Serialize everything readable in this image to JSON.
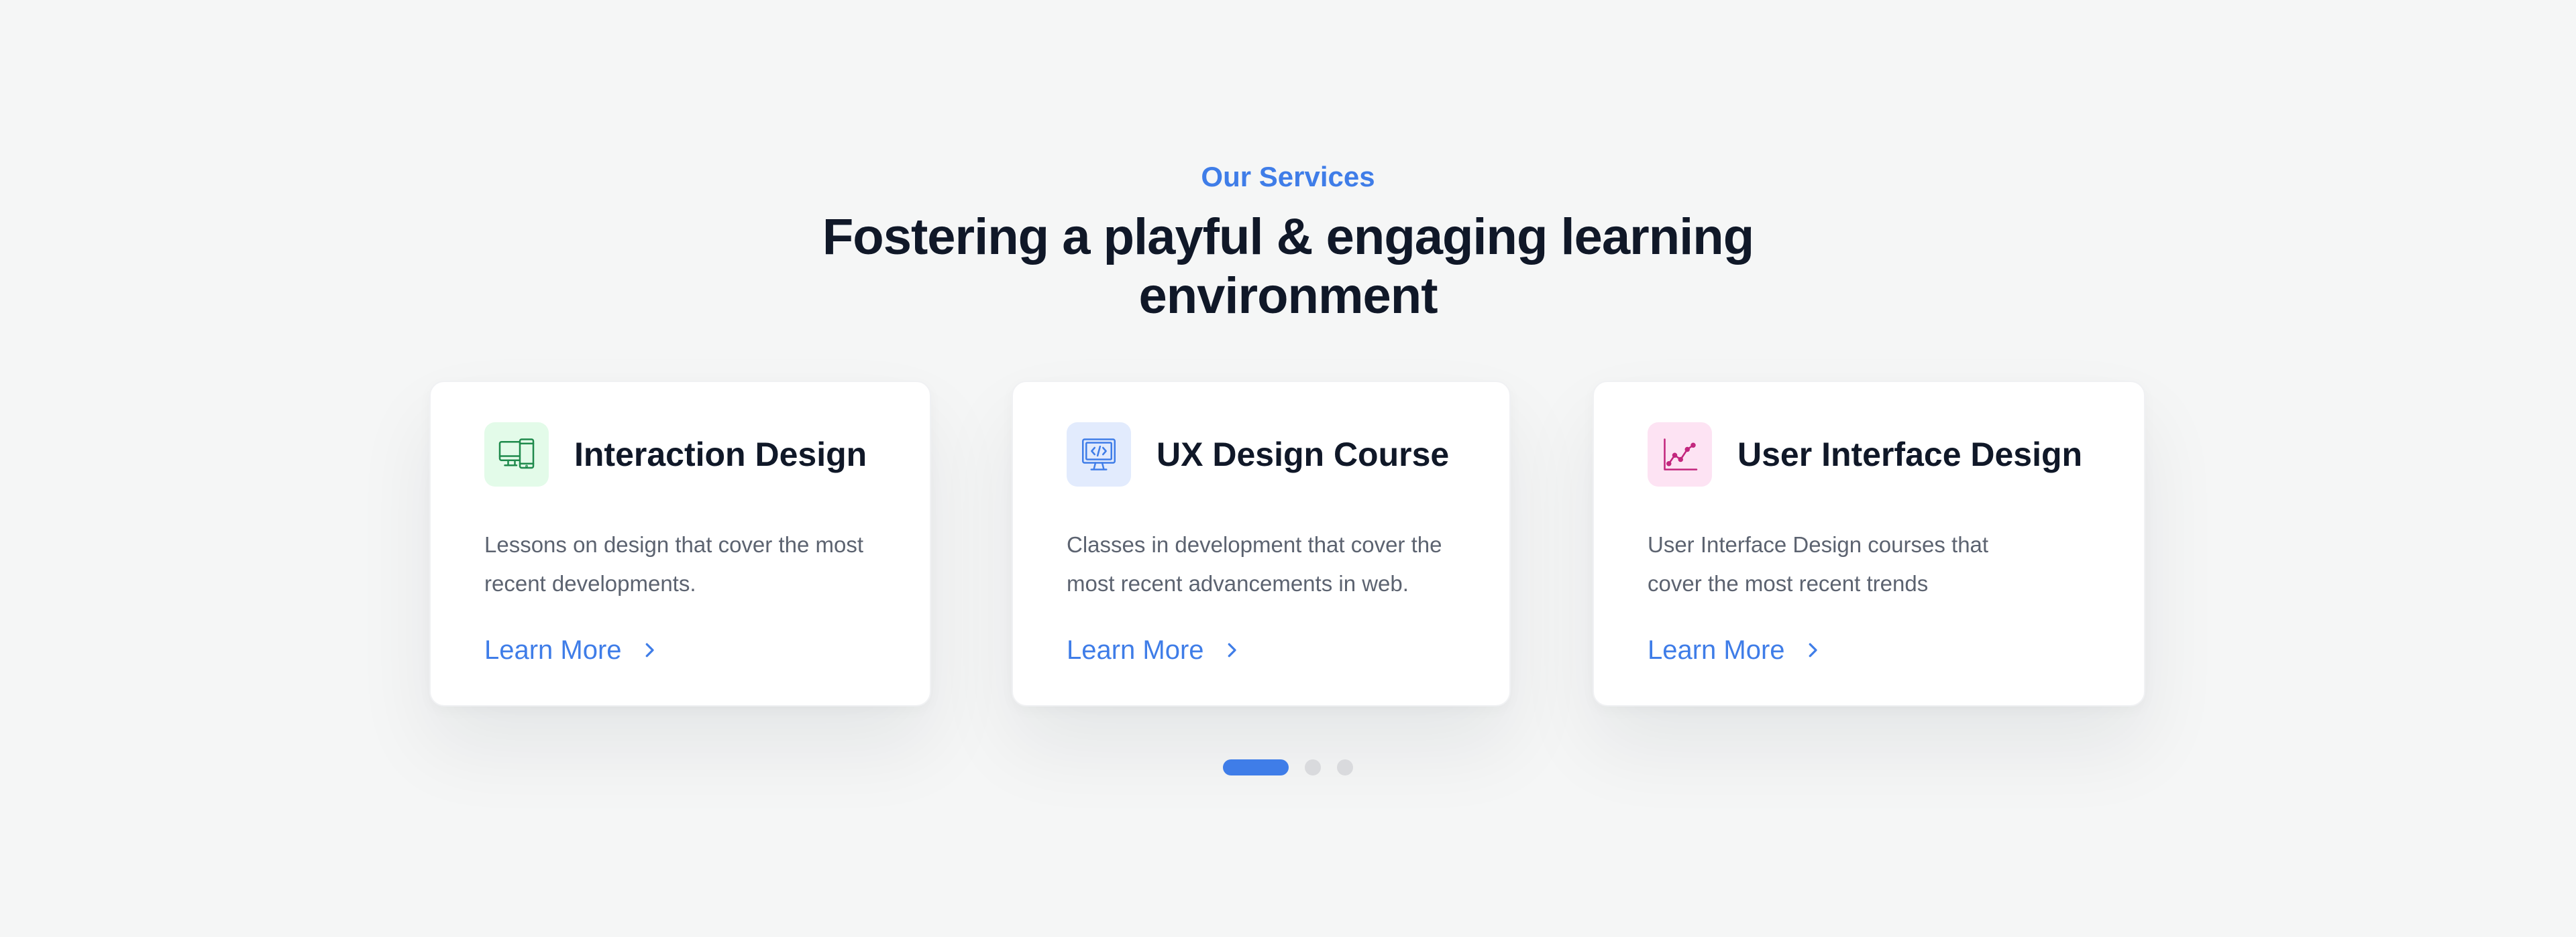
{
  "header": {
    "eyebrow": "Our Services",
    "title": "Fostering a playful & engaging learning environment"
  },
  "cards": [
    {
      "title": "Interaction Design",
      "description": "Lessons on design that cover the most recent developments.",
      "link_label": "Learn More",
      "icon": "devices-icon",
      "tile_color": "#e3fbe9",
      "icon_color": "#1f8a4c"
    },
    {
      "title": "UX Design Course",
      "description": "Classes in development that cover the most recent advancements in web.",
      "link_label": "Learn More",
      "icon": "monitor-code-icon",
      "tile_color": "#e2ebfd",
      "icon_color": "#3f7de8"
    },
    {
      "title": "User Interface Design",
      "description": "User Interface Design courses that cover the most recent  trends",
      "link_label": "Learn More",
      "icon": "chart-line-icon",
      "tile_color": "#fde3f3",
      "icon_color": "#c2247c"
    }
  ],
  "pagination": {
    "total": 3,
    "active": 1
  },
  "colors": {
    "accent": "#3f7de8",
    "heading": "#101828",
    "body": "#5c6370",
    "background": "#f5f6f6"
  }
}
